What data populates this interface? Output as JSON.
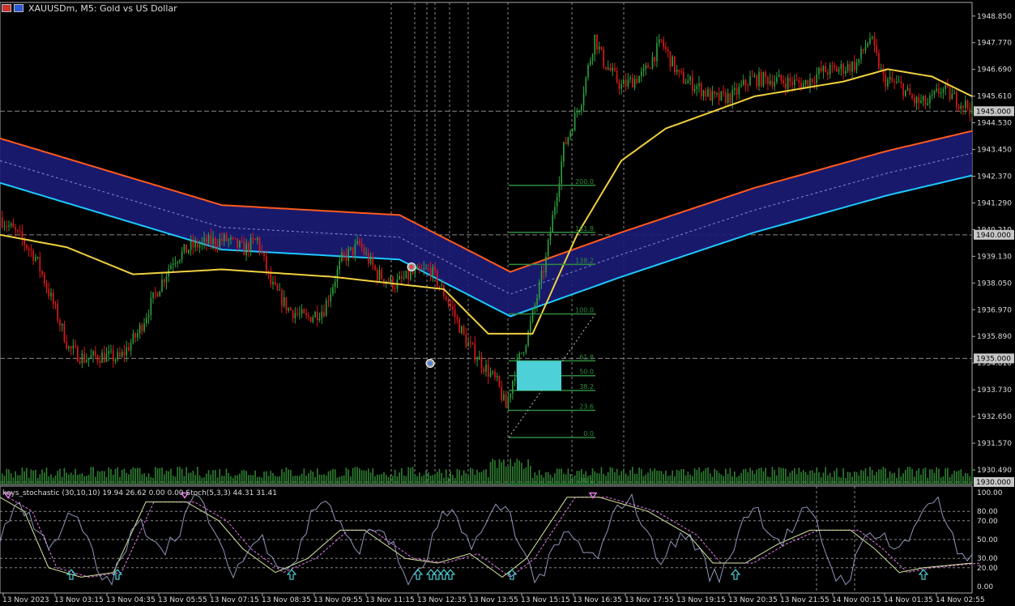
{
  "window": {
    "title": "XAUUSDm, M5:  Gold vs US Dollar",
    "icon_a": "chart-window-icon",
    "icon_b": "restore-icon"
  },
  "subwindow": {
    "label": "keys_stochastic (30,10,10) 19.94 26.62 0.00 0.00 Stoch(5,3,3) 44.31 31.41",
    "scale": [
      "100.00",
      "80.00",
      "70.00",
      "50.00",
      "30.00",
      "20.00",
      "0.00"
    ]
  },
  "price_axis": {
    "labels": [
      "1948.850",
      "1947.770",
      "1946.690",
      "1945.610",
      "1944.530",
      "1943.450",
      "1942.370",
      "1941.290",
      "1940.210",
      "1939.130",
      "1938.050",
      "1936.970",
      "1935.890",
      "1934.810",
      "1933.730",
      "1932.650",
      "1931.570",
      "1930.490"
    ],
    "levels": [
      "1945.000",
      "1940.000",
      "1935.000",
      "1930.000"
    ]
  },
  "time_axis": [
    "13 Nov 2023",
    "13 Nov 03:15",
    "13 Nov 04:35",
    "13 Nov 05:55",
    "13 Nov 07:15",
    "13 Nov 08:35",
    "13 Nov 09:55",
    "13 Nov 11:15",
    "13 Nov 12:35",
    "13 Nov 13:55",
    "13 Nov 15:15",
    "13 Nov 16:35",
    "13 Nov 17:55",
    "13 Nov 19:15",
    "13 Nov 20:35",
    "13 Nov 21:55",
    "14 Nov 00:15",
    "14 Nov 01:35",
    "14 Nov 02:55"
  ],
  "fibonacci": [
    "200.0",
    "161.8",
    "138.2",
    "100.0",
    "61.8",
    "50.0",
    "38.2",
    "23.6",
    "0.0",
    "-38.2"
  ],
  "colors": {
    "background": "#000000",
    "bull": "#2e9e3e",
    "bear": "#e01818",
    "band": "#1c1c78",
    "band_upper": "#ff5a1e",
    "band_lower": "#1ec8ff",
    "ma": "#f0d040",
    "fib": "#2e8b3e",
    "zone": "#4dd0d8",
    "stoch_main": "#d8e8a0",
    "stoch_signal": "#e878e8",
    "osc": "#a8b0d8",
    "grid": "#888888"
  },
  "chart_data": {
    "type": "candlestick",
    "symbol": "XAUUSDm",
    "timeframe": "M5",
    "ylim": [
      1929.9,
      1949.4
    ],
    "levels": [
      1945.0,
      1940.0,
      1935.0,
      1930.0
    ],
    "path_points": [
      [
        0,
        1940.7
      ],
      [
        8,
        1940.0
      ],
      [
        16,
        1939.1
      ],
      [
        24,
        1937.2
      ],
      [
        31,
        1935.4
      ],
      [
        38,
        1935.0
      ],
      [
        46,
        1935.1
      ],
      [
        54,
        1935.0
      ],
      [
        62,
        1936.0
      ],
      [
        70,
        1937.6
      ],
      [
        78,
        1939.0
      ],
      [
        86,
        1939.5
      ],
      [
        94,
        1939.7
      ],
      [
        102,
        1939.8
      ],
      [
        110,
        1939.4
      ],
      [
        116,
        1939.8
      ],
      [
        122,
        1938.0
      ],
      [
        130,
        1937.0
      ],
      [
        138,
        1936.6
      ],
      [
        146,
        1937.0
      ],
      [
        154,
        1939.0
      ],
      [
        162,
        1939.6
      ],
      [
        170,
        1938.4
      ],
      [
        178,
        1938.0
      ],
      [
        186,
        1938.4
      ],
      [
        194,
        1938.6
      ],
      [
        202,
        1937.3
      ],
      [
        210,
        1935.7
      ],
      [
        218,
        1934.7
      ],
      [
        224,
        1934.0
      ],
      [
        228,
        1933.0
      ],
      [
        232,
        1934.5
      ],
      [
        238,
        1936.0
      ],
      [
        246,
        1939.0
      ],
      [
        254,
        1943.5
      ],
      [
        262,
        1945.5
      ],
      [
        268,
        1948.0
      ],
      [
        272,
        1947.0
      ],
      [
        280,
        1946.0
      ],
      [
        290,
        1946.5
      ],
      [
        298,
        1947.8
      ],
      [
        306,
        1946.4
      ],
      [
        314,
        1946.0
      ],
      [
        322,
        1945.5
      ],
      [
        330,
        1945.6
      ],
      [
        338,
        1946.3
      ],
      [
        346,
        1946.3
      ],
      [
        354,
        1946.2
      ],
      [
        362,
        1946.1
      ],
      [
        370,
        1946.6
      ],
      [
        378,
        1946.7
      ],
      [
        386,
        1946.9
      ],
      [
        392,
        1948.0
      ],
      [
        398,
        1946.3
      ],
      [
        406,
        1946.0
      ],
      [
        412,
        1945.4
      ],
      [
        418,
        1945.3
      ],
      [
        424,
        1945.9
      ],
      [
        432,
        1945.4
      ],
      [
        438,
        1945.1
      ]
    ],
    "ma_slow_points": [
      [
        0,
        1940.0
      ],
      [
        30,
        1939.5
      ],
      [
        60,
        1938.4
      ],
      [
        100,
        1938.6
      ],
      [
        150,
        1938.3
      ],
      [
        200,
        1937.8
      ],
      [
        220,
        1936.0
      ],
      [
        240,
        1936.0
      ],
      [
        260,
        1940.0
      ],
      [
        280,
        1943.0
      ],
      [
        300,
        1944.3
      ],
      [
        340,
        1945.6
      ],
      [
        380,
        1946.2
      ],
      [
        400,
        1946.7
      ],
      [
        420,
        1946.4
      ],
      [
        438,
        1945.6
      ]
    ],
    "band_center_points": [
      [
        0,
        1943.0
      ],
      [
        100,
        1940.3
      ],
      [
        180,
        1939.9
      ],
      [
        230,
        1937.6
      ],
      [
        280,
        1939.2
      ],
      [
        340,
        1941.0
      ],
      [
        400,
        1942.5
      ],
      [
        438,
        1943.3
      ]
    ],
    "fib_levels": [
      {
        "label": "200.0",
        "value": 1942.0
      },
      {
        "label": "161.8",
        "value": 1940.1
      },
      {
        "label": "138.2",
        "value": 1938.8
      },
      {
        "label": "100.0",
        "value": 1936.8
      },
      {
        "label": "61.8",
        "value": 1934.9
      },
      {
        "label": "50.0",
        "value": 1934.3
      },
      {
        "label": "38.2",
        "value": 1933.7
      },
      {
        "label": "23.6",
        "value": 1932.9
      },
      {
        "label": "0.0",
        "value": 1931.8
      },
      {
        "label": "-38.2",
        "value": 1929.9
      }
    ]
  }
}
